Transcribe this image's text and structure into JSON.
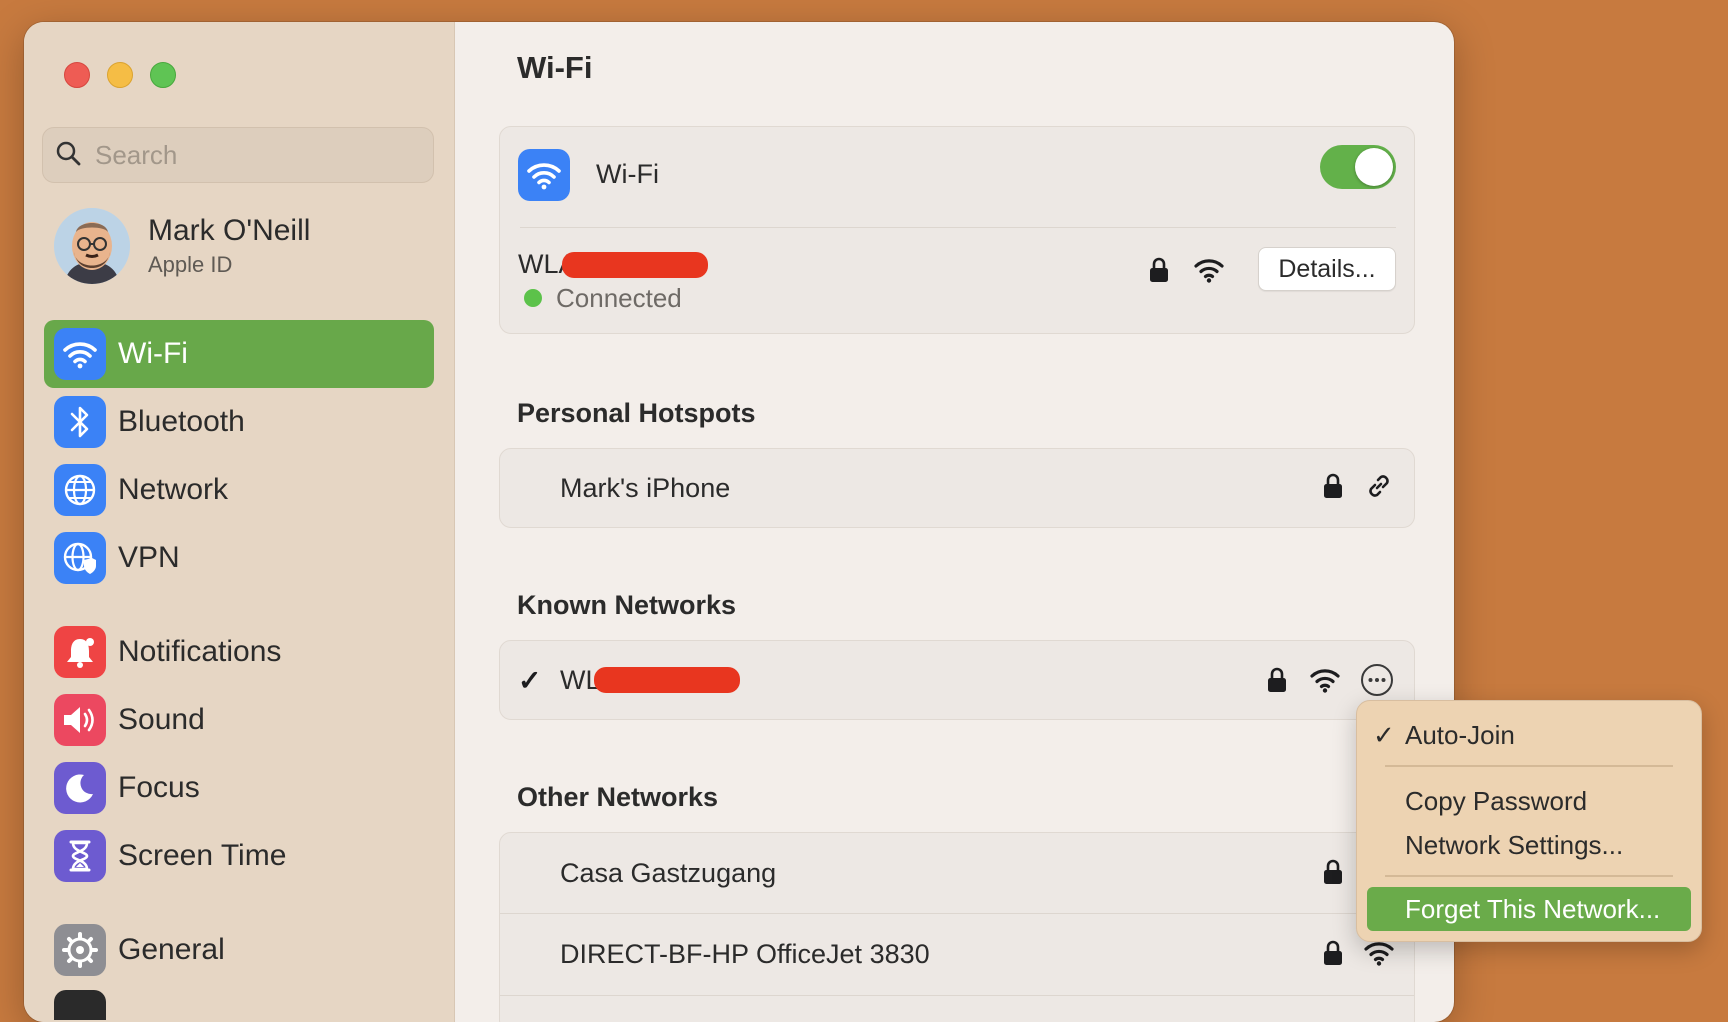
{
  "sidebar": {
    "search": {
      "placeholder": "Search",
      "value": ""
    },
    "profile": {
      "name": "Mark O'Neill",
      "subtitle": "Apple ID"
    },
    "items": [
      {
        "label": "Wi-Fi",
        "icon": "wifi-icon",
        "color": "#3b82f6",
        "active": true
      },
      {
        "label": "Bluetooth",
        "icon": "bluetooth-icon",
        "color": "#3b82f6"
      },
      {
        "label": "Network",
        "icon": "globe-icon",
        "color": "#3b82f6"
      },
      {
        "label": "VPN",
        "icon": "vpn-globe-icon",
        "color": "#3b82f6"
      },
      {
        "label": "Notifications",
        "icon": "bell-icon",
        "color": "#ef4444"
      },
      {
        "label": "Sound",
        "icon": "speaker-icon",
        "color": "#ec4860"
      },
      {
        "label": "Focus",
        "icon": "moon-icon",
        "color": "#6d5bd0"
      },
      {
        "label": "Screen Time",
        "icon": "hourglass-icon",
        "color": "#6d5bd0"
      },
      {
        "label": "General",
        "icon": "gear-icon",
        "color": "#8e8e93"
      }
    ]
  },
  "main": {
    "title": "Wi-Fi",
    "wifi_card": {
      "label": "Wi-Fi",
      "toggle_on": true,
      "current_network_prefix": "WLA",
      "status": "Connected",
      "details_label": "Details..."
    },
    "hotspots": {
      "title": "Personal Hotspots",
      "items": [
        {
          "name": "Mark's iPhone"
        }
      ]
    },
    "known": {
      "title": "Known Networks",
      "items": [
        {
          "name_prefix": "WL",
          "check": "✓"
        }
      ]
    },
    "other": {
      "title": "Other Networks",
      "items": [
        {
          "name": "Casa Gastzugang"
        },
        {
          "name": "DIRECT-BF-HP OfficeJet 3830"
        }
      ]
    }
  },
  "context_menu": {
    "items": [
      {
        "label": "Auto-Join",
        "checked": true,
        "check": "✓"
      },
      {
        "label": "Copy Password"
      },
      {
        "label": "Network Settings..."
      },
      {
        "label": "Forget This Network...",
        "highlighted": true
      }
    ]
  },
  "colors": {
    "accent_green": "#68a84a",
    "toggle_green": "#63b14a",
    "status_green": "#5cc24a",
    "background": "#c77a3f"
  }
}
